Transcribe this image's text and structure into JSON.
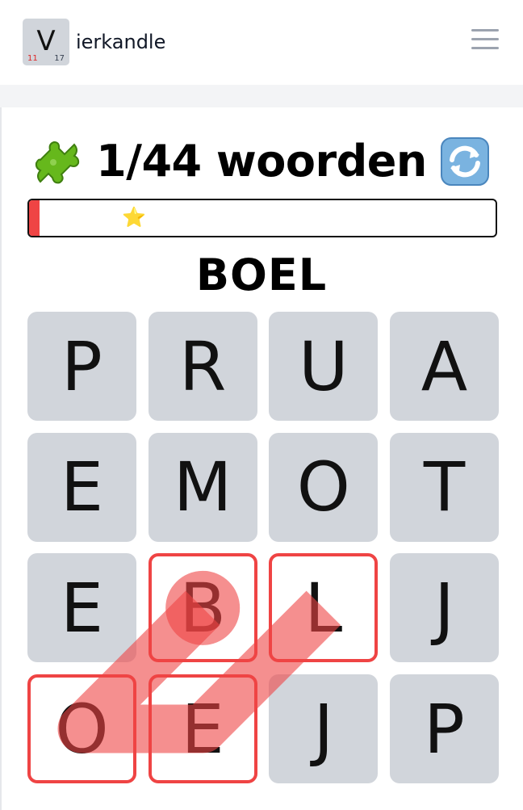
{
  "header": {
    "logo": {
      "letter": "V",
      "num_left": "11",
      "num_right": "17"
    },
    "title": "ierkandle",
    "menu_icon": "hamburger-menu-icon"
  },
  "score": {
    "left_icon": "puzzle-piece-icon",
    "text": "1/44 woorden",
    "right_icon": "refresh-icon"
  },
  "progress": {
    "fraction": 0.023,
    "star": "⭐",
    "fill_color": "#ef4444"
  },
  "current_word": "BOEL",
  "board": {
    "rows": [
      [
        "P",
        "R",
        "U",
        "A"
      ],
      [
        "E",
        "M",
        "O",
        "T"
      ],
      [
        "E",
        "B",
        "L",
        "J"
      ],
      [
        "O",
        "E",
        "J",
        "P"
      ]
    ],
    "path": [
      [
        2,
        1
      ],
      [
        3,
        0
      ],
      [
        3,
        1
      ],
      [
        2,
        2
      ]
    ],
    "highlight_color": "#ef4444",
    "tile_color": "#d1d5db"
  }
}
